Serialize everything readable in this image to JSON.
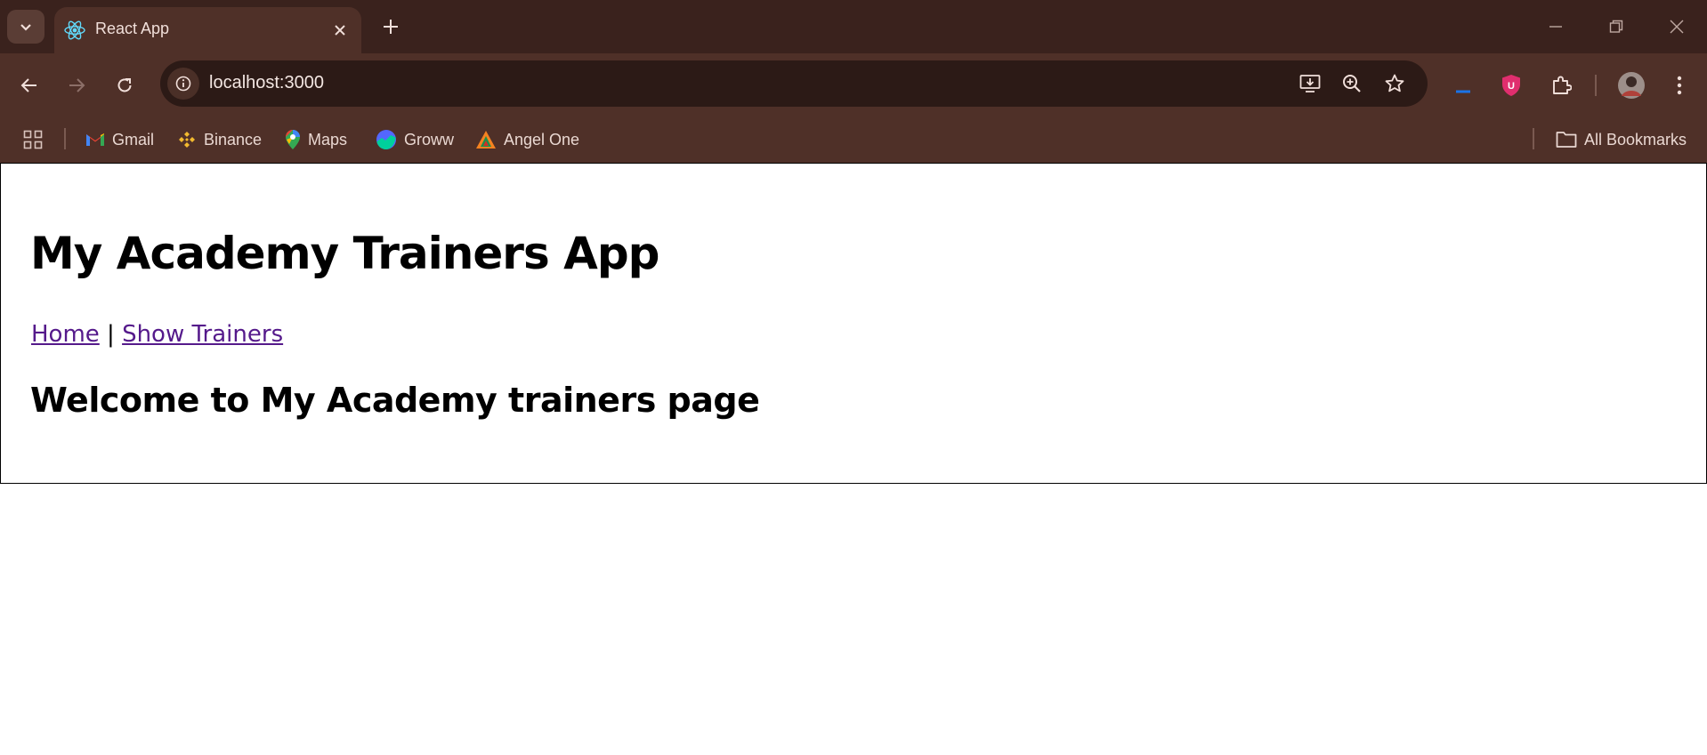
{
  "browser": {
    "tab": {
      "title": "React App"
    },
    "address": {
      "url": "localhost:3000"
    },
    "bookmarks": [
      {
        "label": "Gmail",
        "icon": "gmail-icon"
      },
      {
        "label": "Binance",
        "icon": "binance-icon"
      },
      {
        "label": "Maps",
        "icon": "maps-icon"
      },
      {
        "label": "Groww",
        "icon": "groww-icon"
      },
      {
        "label": "Angel One",
        "icon": "angel-one-icon"
      }
    ],
    "all_bookmarks_label": "All Bookmarks",
    "colors": {
      "tabstrip": "#3a221d",
      "toolbar": "#4f3028",
      "omnibox": "#2c1a16"
    }
  },
  "page": {
    "title": "My Academy Trainers App",
    "nav": {
      "home": "Home",
      "separator": "|",
      "show_trainers": "Show Trainers"
    },
    "welcome": "Welcome to My Academy trainers page",
    "colors": {
      "link_visited": "#551a8b"
    }
  }
}
